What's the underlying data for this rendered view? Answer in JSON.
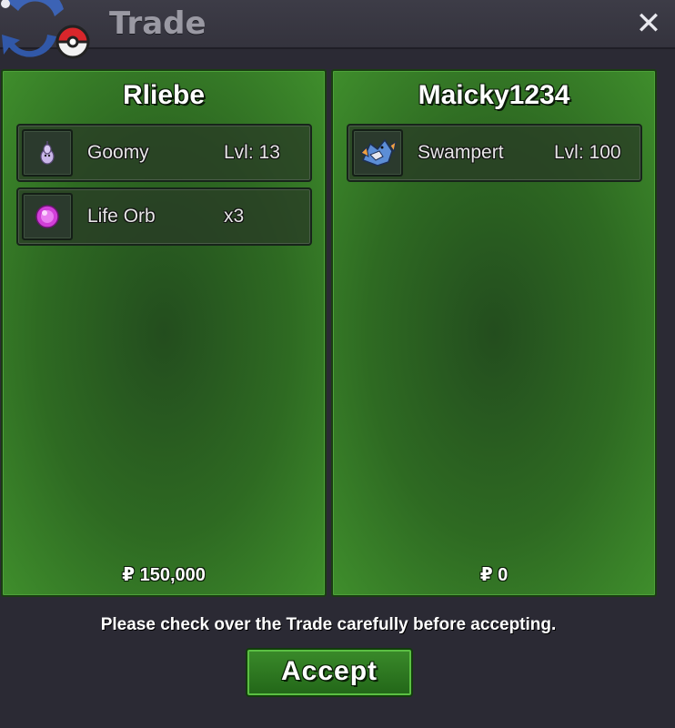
{
  "window": {
    "title": "Trade",
    "close_label": "✕",
    "icons": {
      "logo": "trade-logo-icon",
      "close": "close-icon"
    }
  },
  "left_panel": {
    "player": "Rliebe",
    "items": [
      {
        "name": "Goomy",
        "extra": "Lvl: 13",
        "icon": "goomy-sprite-icon"
      },
      {
        "name": "Life Orb",
        "extra": "x3",
        "icon": "life-orb-icon"
      }
    ],
    "money": "₽ 150,000"
  },
  "right_panel": {
    "player": "Maicky1234",
    "items": [
      {
        "name": "Swampert",
        "extra": "Lvl: 100",
        "icon": "swampert-sprite-icon"
      }
    ],
    "money": "₽ 0"
  },
  "footer": {
    "notice": "Please check over the Trade carefully before accepting.",
    "accept_label": "Accept"
  },
  "colors": {
    "panel_green": "#2e6a22",
    "window_bg": "#2b2a34",
    "accept_green": "#3a8a2a"
  }
}
